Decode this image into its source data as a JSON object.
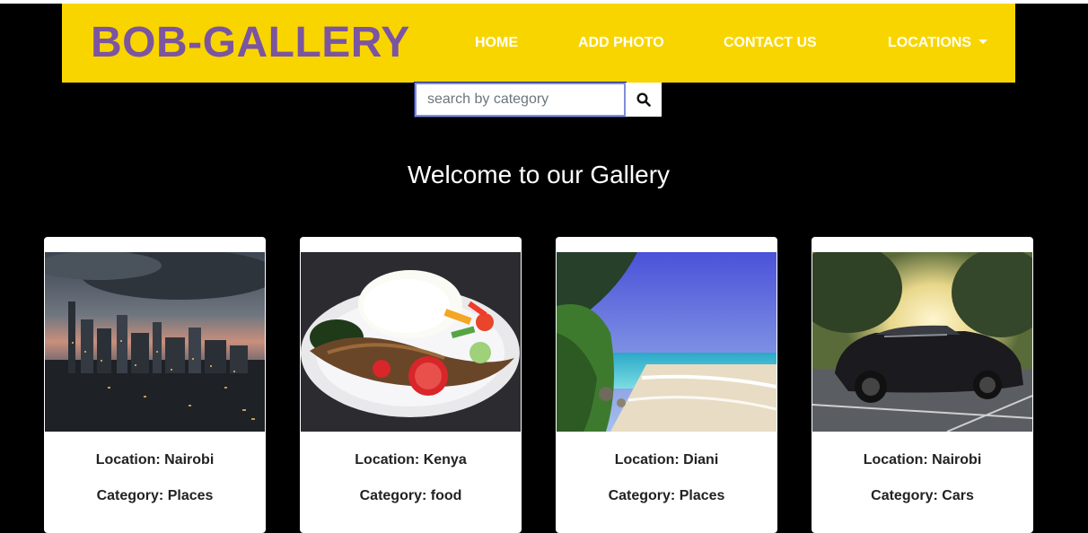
{
  "navbar": {
    "brand": "BOB-GALLERY",
    "links": [
      {
        "label": "HOME"
      },
      {
        "label": "ADD PHOTO"
      },
      {
        "label": "CONTACT US"
      },
      {
        "label": "LOCATIONS"
      }
    ]
  },
  "search": {
    "placeholder": "search by category",
    "icon": "search-icon"
  },
  "main": {
    "heading": "Welcome to our Gallery"
  },
  "cards": [
    {
      "location": "Location: Nairobi",
      "category": "Category: Places",
      "image": "nairobi-city-skyline"
    },
    {
      "location": "Location: Kenya",
      "category": "Category: food",
      "image": "fish-rice-plate"
    },
    {
      "location": "Location: Diani",
      "category": "Category: Places",
      "image": "diani-beach"
    },
    {
      "location": "Location: Nairobi",
      "category": "Category: Cars",
      "image": "black-mustang-car"
    }
  ],
  "colors": {
    "navbar_bg": "#f9d500",
    "brand": "#7b55a0",
    "page_bg": "#000000",
    "nav_text": "#ffffff"
  }
}
